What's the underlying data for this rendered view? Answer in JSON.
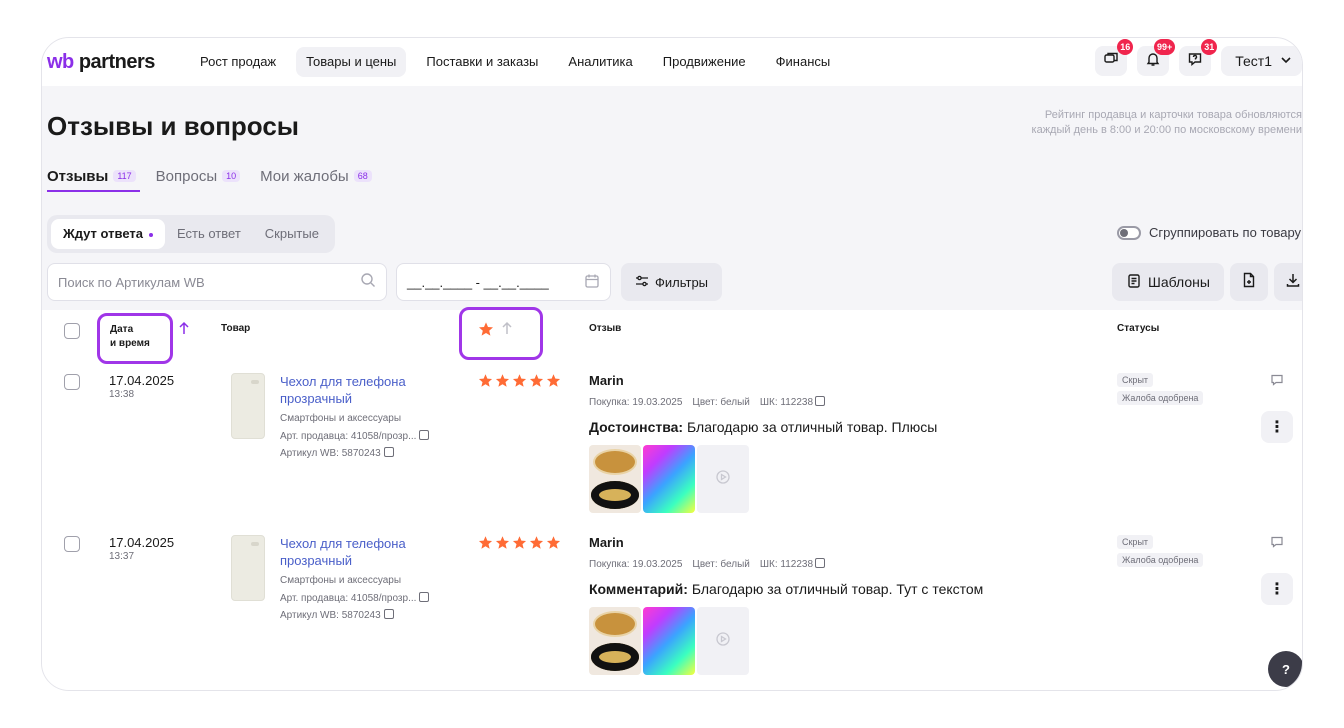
{
  "header": {
    "logo_wb": "wb",
    "logo_rest": " partners",
    "nav": [
      "Рост продаж",
      "Товары и цены",
      "Поставки и заказы",
      "Аналитика",
      "Продвижение",
      "Финансы"
    ],
    "active_nav": "Товары и цены",
    "badges": {
      "chat": "16",
      "notifications": "99+",
      "questions": "31"
    },
    "user": "Тест1",
    "icons": [
      "chat-icon",
      "bell-icon",
      "question-bubble-icon",
      "chevron-down-icon"
    ]
  },
  "page": {
    "title": "Отзывы и вопросы",
    "note_line1": "Рейтинг продавца и карточки товара обновляются",
    "note_line2": "каждый день в 8:00 и 20:00 по московскому времени"
  },
  "tabs": [
    {
      "label": "Отзывы",
      "count": "117"
    },
    {
      "label": "Вопросы",
      "count": "10"
    },
    {
      "label": "Мои жалобы",
      "count": "68"
    }
  ],
  "segments": [
    "Ждут ответа",
    "Есть ответ",
    "Скрытые"
  ],
  "group_toggle": "Сгруппировать по товару",
  "search": {
    "placeholder": "Поиск по Артикулам WB"
  },
  "date_range": {
    "value": "__.__.____ - __.__.____"
  },
  "buttons": {
    "filters": "Фильтры",
    "templates": "Шаблоны"
  },
  "table": {
    "headers": {
      "date_line1": "Дата",
      "date_line2": "и время",
      "product": "Товар",
      "review": "Отзыв",
      "statuses": "Статусы"
    },
    "rows": [
      {
        "date": "17.04.2025",
        "time": "13:38",
        "product_name": "Чехол для телефона прозрачный",
        "category": "Смартфоны и аксессуары",
        "seller_article": "Арт. продавца: 41058/прозр...",
        "wb_article": "Артикул WB: 5870243",
        "rating": 5,
        "author": "Marin",
        "purchase": "Покупка: 19.03.2025",
        "color": "Цвет: белый",
        "barcode": "ШК: 112238",
        "text_label": "Достоинства:",
        "text": "Благодарю за отличный товар. Плюсы",
        "statuses": [
          "Скрыт",
          "Жалоба одобрена"
        ]
      },
      {
        "date": "17.04.2025",
        "time": "13:37",
        "product_name": "Чехол для телефона прозрачный",
        "category": "Смартфоны и аксессуары",
        "seller_article": "Арт. продавца: 41058/прозр...",
        "wb_article": "Артикул WB: 5870243",
        "rating": 5,
        "author": "Marin",
        "purchase": "Покупка: 19.03.2025",
        "color": "Цвет: белый",
        "barcode": "ШК: 112238",
        "text_label": "Комментарий:",
        "text": "Благодарю за отличный товар. Тут с текстом",
        "statuses": [
          "Скрыт",
          "Жалоба одобрена"
        ]
      }
    ]
  },
  "help": "?",
  "colors": {
    "accent": "#8b2fe8",
    "star": "#ff6b35",
    "link": "#4a5fc9",
    "badge": "#f0254d",
    "highlight": "#a036e8"
  }
}
